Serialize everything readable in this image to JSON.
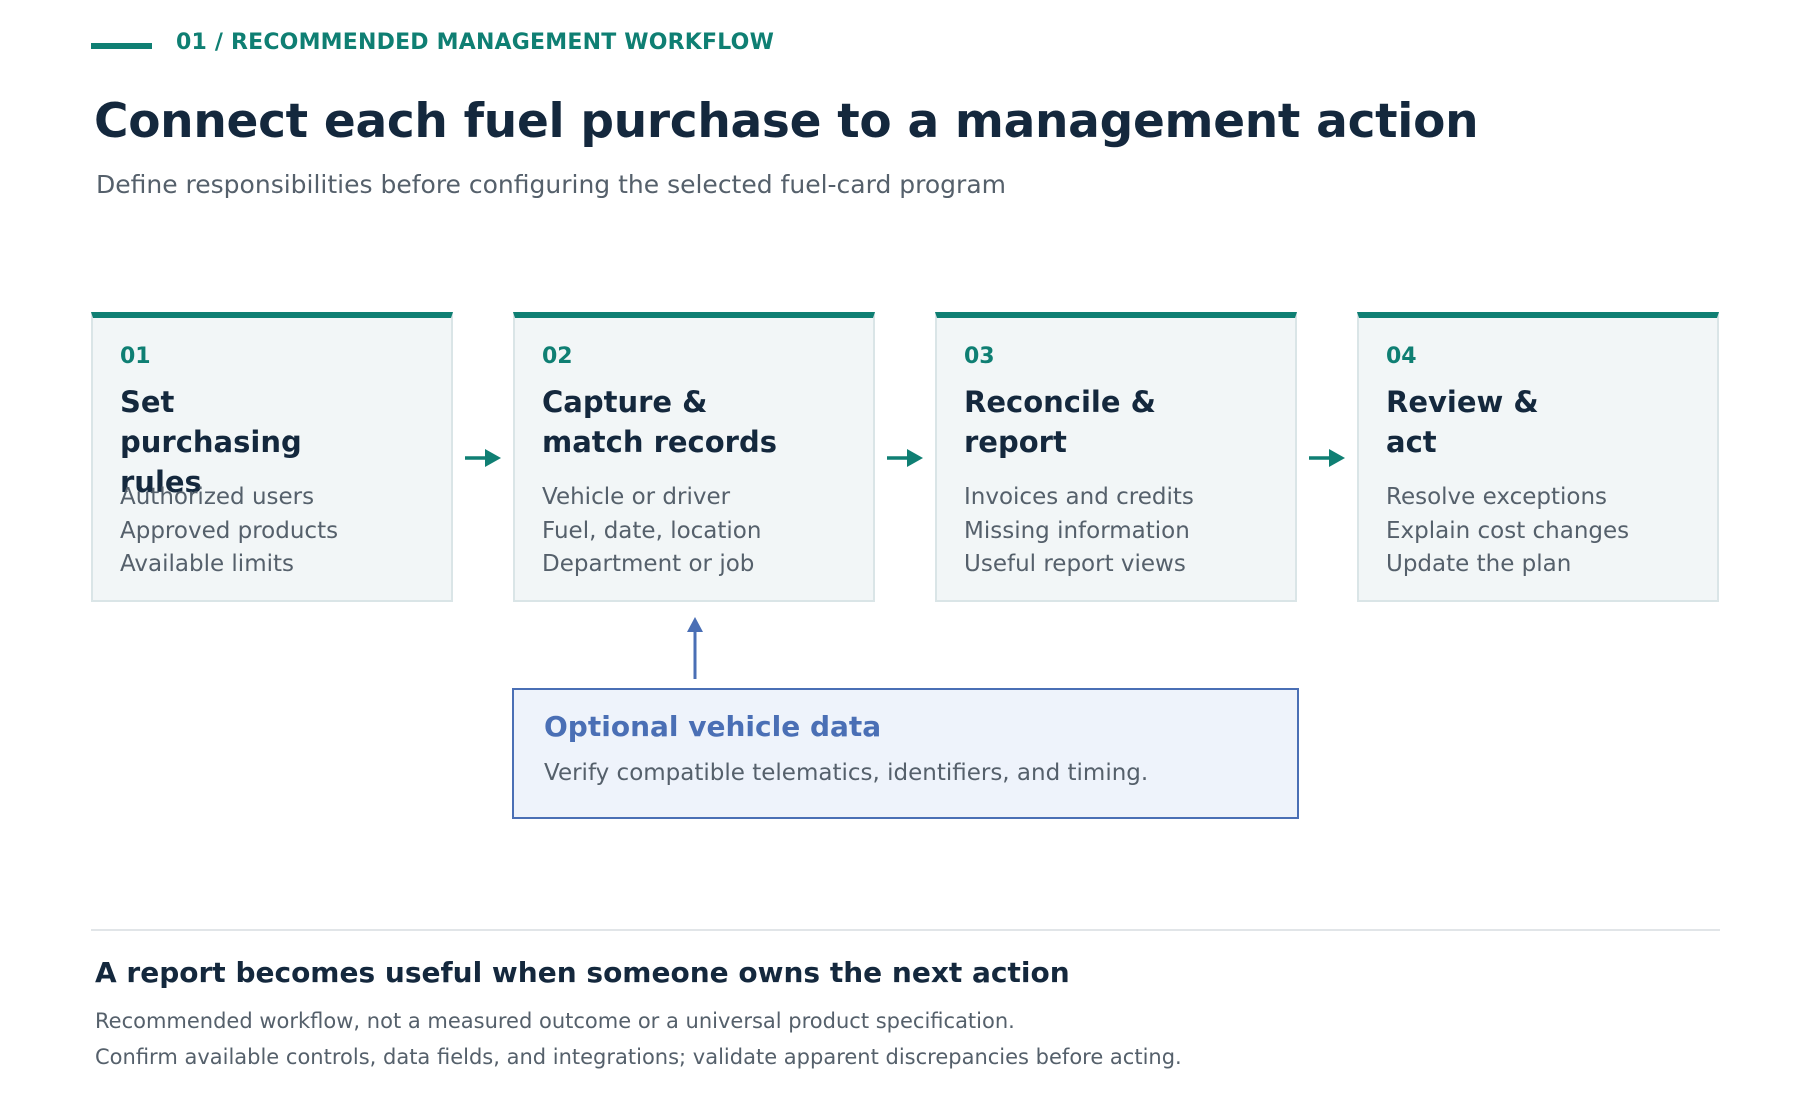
{
  "header": {
    "eyebrow": "01 / RECOMMENDED MANAGEMENT WORKFLOW",
    "title": "Connect each fuel purchase to a management action",
    "subtitle": "Define responsibilities before configuring the selected fuel-card program"
  },
  "steps": [
    {
      "num": "01",
      "title": "Set purchasing rules",
      "items": [
        "Authorized users",
        "Approved products",
        "Available limits"
      ]
    },
    {
      "num": "02",
      "title": "Capture & match records",
      "items": [
        "Vehicle or driver",
        "Fuel, date, location",
        "Department or job"
      ]
    },
    {
      "num": "03",
      "title": "Reconcile & report",
      "items": [
        "Invoices and credits",
        "Missing information",
        "Useful report views"
      ]
    },
    {
      "num": "04",
      "title": "Review & act",
      "items": [
        "Resolve exceptions",
        "Explain cost changes",
        "Update the plan"
      ]
    }
  ],
  "optional": {
    "title": "Optional vehicle data",
    "text": "Verify compatible telematics, identifiers, and timing."
  },
  "footer": {
    "title": "A report becomes useful when someone owns the next action",
    "lines": [
      "Recommended workflow, not a measured outcome or a universal product specification.",
      "Confirm available controls, data fields, and integrations; validate apparent discrepancies before acting."
    ]
  },
  "colors": {
    "accent": "#0f7f73",
    "navy": "#14283d",
    "muted": "#55606b",
    "optional_blue": "#4a6fb5"
  }
}
